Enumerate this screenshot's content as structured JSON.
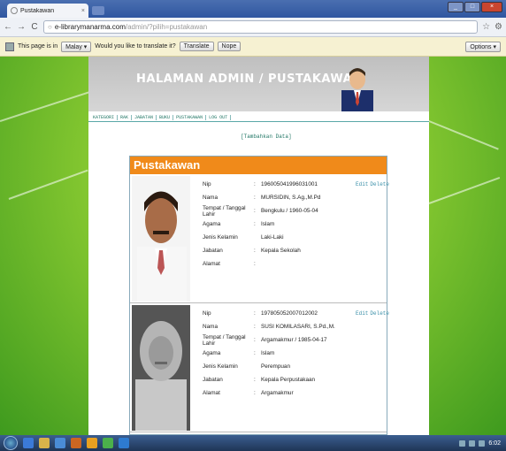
{
  "browser": {
    "tab_title": "Pustakawan",
    "url_host": "e-librarymanarma.com",
    "url_path": "/admin/?pilih=pustakawan"
  },
  "translate_bar": {
    "prefix": "This page is in",
    "language": "Malay",
    "question": "Would you like to translate it?",
    "translate_label": "Translate",
    "nope_label": "Nope",
    "options_label": "Options"
  },
  "site": {
    "banner_title": "HALAMAN ADMIN / PUSTAKAWAN",
    "menu": [
      "KATEGORI",
      "RAK",
      "JABATAN",
      "BUKU",
      "PUSTAKAWAN",
      "LOG OUT"
    ],
    "tambah": "[Tambahkan Data]",
    "panel_title": "Pustakawan",
    "field_labels": [
      "Nip",
      "Nama",
      "Tempat / Tanggal Lahir",
      "Agama",
      "Jenis Kelamin",
      "Jabatan",
      "Alamat"
    ],
    "edit_label": "Edit",
    "delete_label": "Delete",
    "records": [
      {
        "nip": "196005041996031001",
        "nama": "MURSIDIN, S.Ag.,M.Pd",
        "ttl": "Bengkulu / 1960-05-04",
        "agama": "Islam",
        "jk": "Laki-Laki",
        "jabatan": "Kepala Sekolah",
        "alamat": ""
      },
      {
        "nip": "197805052007012002",
        "nama": "SUSI KOMILASARI, S.Pd.,M.",
        "ttl": "Argamakmur / 1985-04-17",
        "agama": "Islam",
        "jk": "Perempuan",
        "jabatan": "Kepala Perpustakaan",
        "alamat": "Argamakmur"
      }
    ]
  },
  "taskbar": {
    "clock": "6:02"
  },
  "colors": {
    "panel_header": "#f08a1a",
    "page_green": "#5fa82a",
    "link": "#3a8fa8"
  }
}
